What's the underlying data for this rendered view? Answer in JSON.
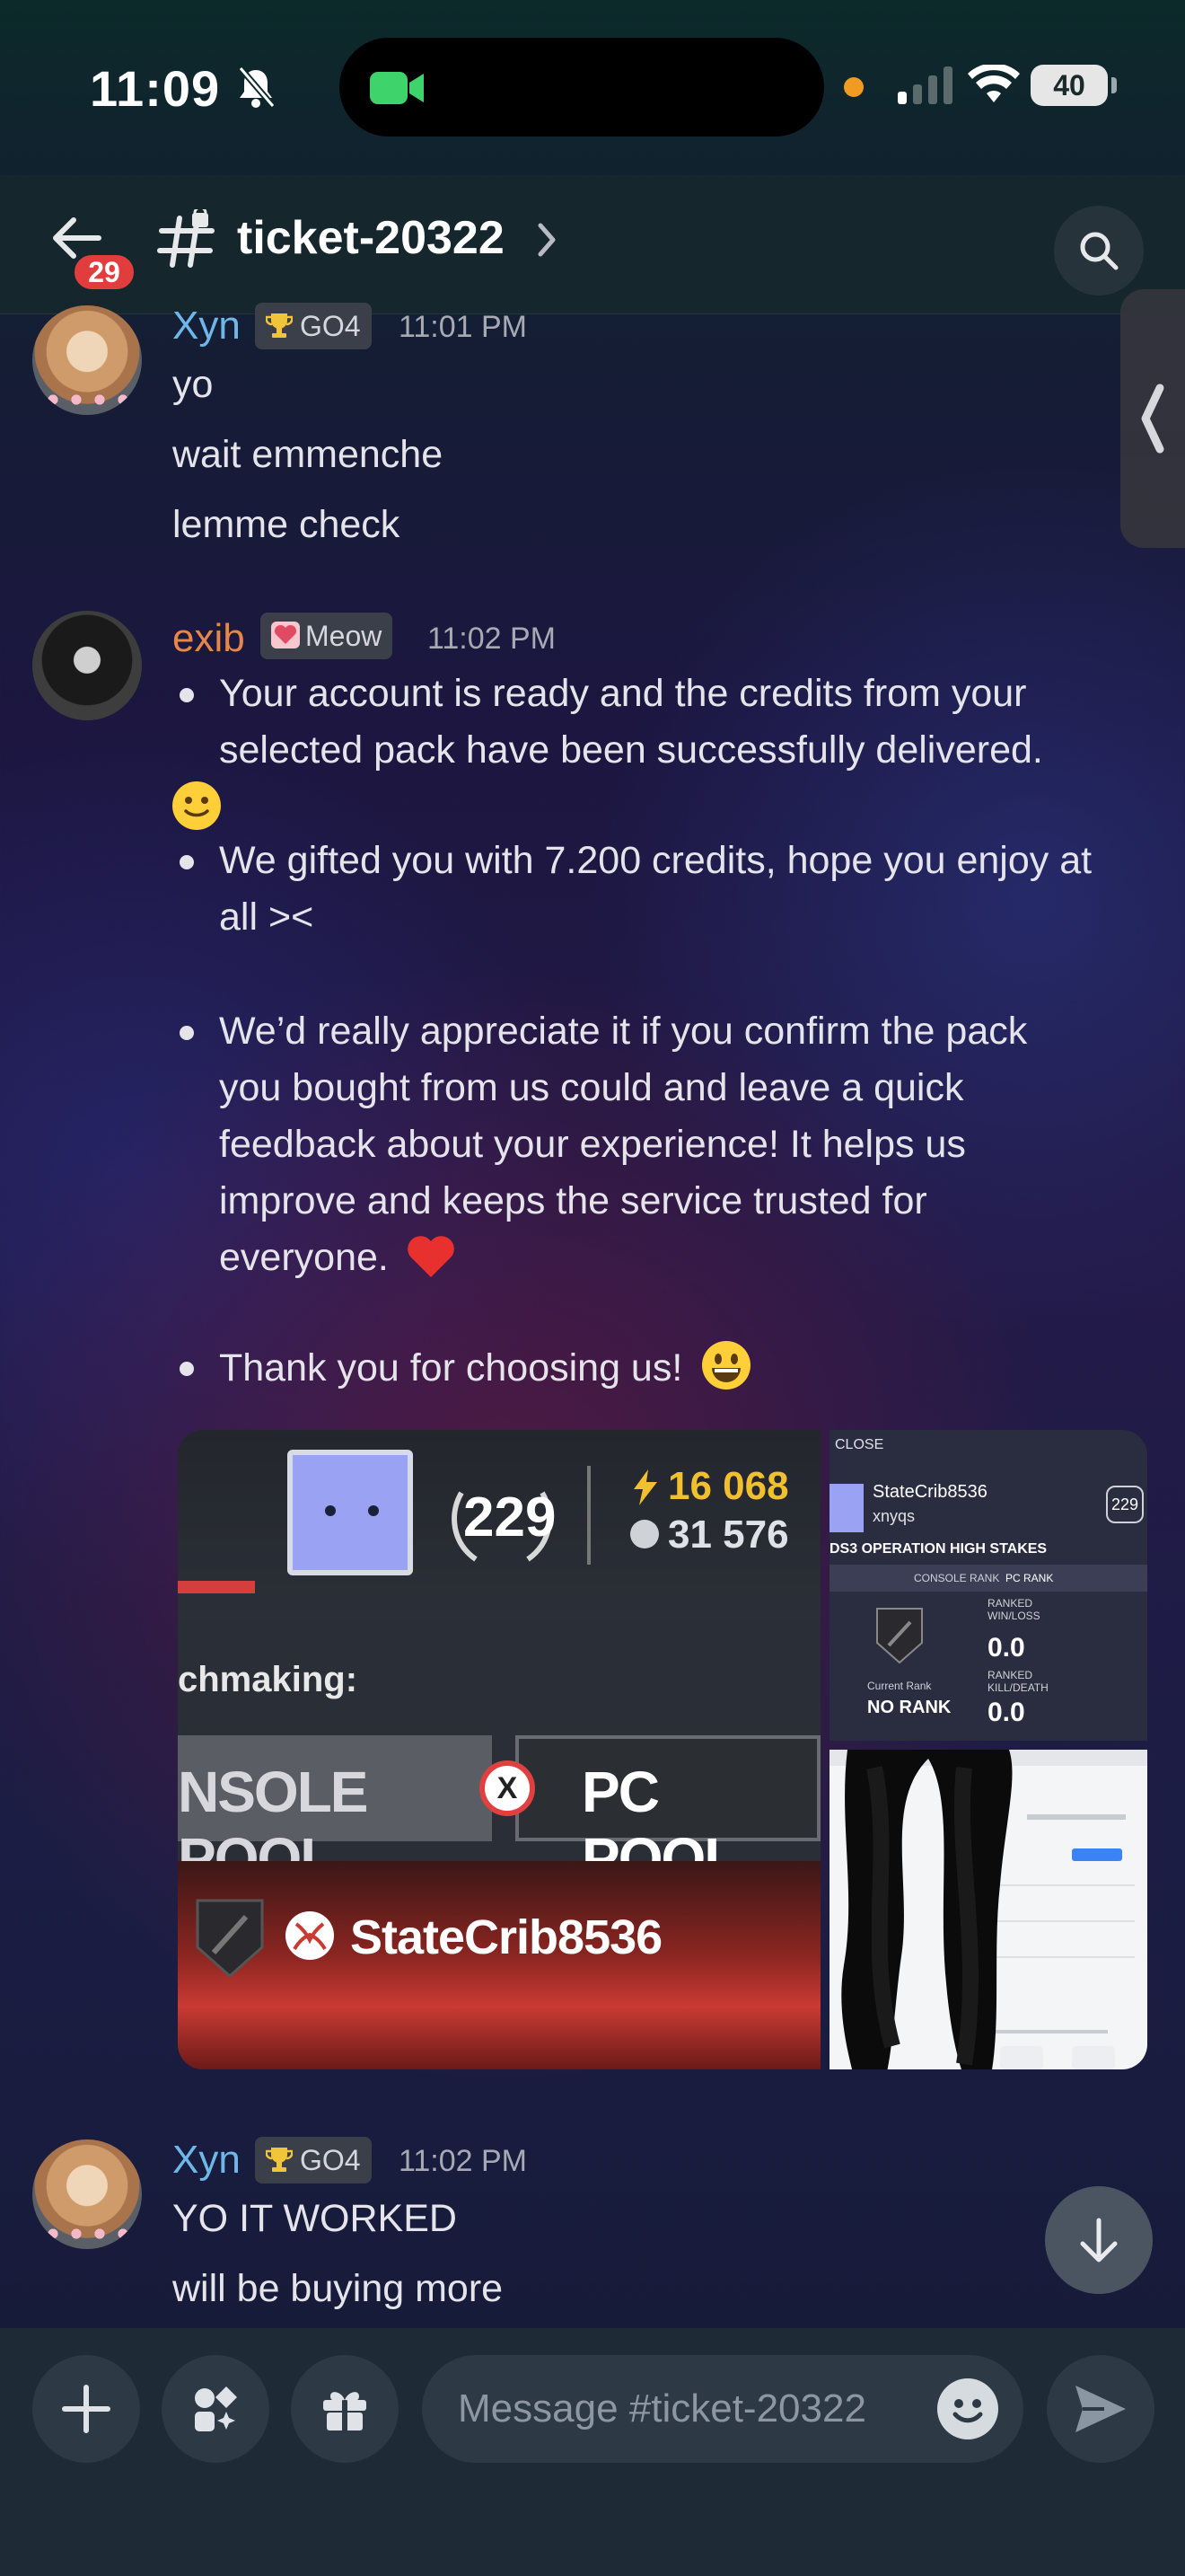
{
  "status_bar": {
    "time": "11:09",
    "battery": "40"
  },
  "header": {
    "channel_name": "ticket-20322",
    "unread_badge": "29"
  },
  "messages": [
    {
      "author": "Xyn",
      "author_color": "#6fb7e8",
      "role": "GO4",
      "timestamp": "11:01 PM",
      "lines": [
        "yo",
        "wait emmenche",
        "lemme check"
      ]
    },
    {
      "author": "exib",
      "author_color": "#e6874a",
      "role": "Meow",
      "timestamp": "11:02 PM",
      "bullets": [
        [
          "Your account is ready and the credits from your",
          "selected pack have been successfully delivered."
        ],
        [
          "We gifted you with 7.200 credits, hope you enjoy at",
          "all ><"
        ],
        [
          "We’d really appreciate it if you confirm the pack",
          "you bought from us could and leave a quick",
          "feedback about your experience! It helps us",
          "improve and keeps the service trusted for",
          "everyone."
        ],
        [
          "Thank you for choosing us!"
        ]
      ],
      "attachments": {
        "main": {
          "level": "229",
          "credits_top": "16 068",
          "credits_bottom": "31 576",
          "matchmaking_label": "chmaking:",
          "console_pool": "NSOLE POOL",
          "pc_pool": "PC POOL",
          "gamertag": "StateCrib8536"
        },
        "side": {
          "close": "CLOSE",
          "gamertag": "StateCrib8536",
          "handle": "xnyqs",
          "level": "229",
          "event": "DS3 OPERATION HIGH STAKES",
          "console_rank": "CONSOLE RANK",
          "pc_rank": "PC RANK",
          "win_loss_label": "RANKED WIN/LOSS",
          "win_loss": "0.0",
          "kd_label": "RANKED KILL/DEATH",
          "kd": "0.0",
          "current_rank_label": "Current Rank",
          "current_rank": "NO RANK"
        }
      }
    },
    {
      "author": "Xyn",
      "author_color": "#6fb7e8",
      "role": "GO4",
      "timestamp": "11:02 PM",
      "lines": [
        "YO IT WORKED",
        "will be buying more"
      ]
    }
  ],
  "composer": {
    "placeholder": "Message #ticket-20322"
  },
  "icons": [
    "back-arrow-icon",
    "hash-icon",
    "chevron-right-icon",
    "search-icon",
    "plus-icon",
    "apps-icon",
    "gift-icon",
    "emoji-icon",
    "send-icon",
    "arrow-down-icon",
    "trophy-icon",
    "heart-icon"
  ]
}
